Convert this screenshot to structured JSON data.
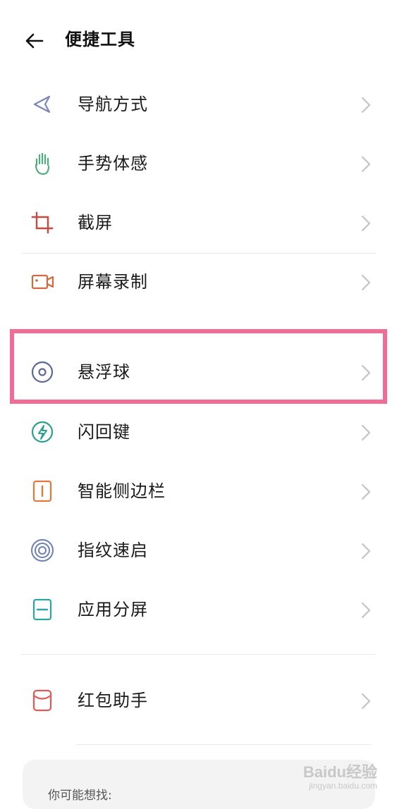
{
  "header": {
    "title": "便捷工具"
  },
  "items": [
    {
      "label": "导航方式",
      "icon": "navigation-arrow-icon"
    },
    {
      "label": "手势体感",
      "icon": "hand-gesture-icon"
    },
    {
      "label": "截屏",
      "icon": "crop-icon"
    },
    {
      "label": "屏幕录制",
      "icon": "video-record-icon"
    },
    {
      "label": "悬浮球",
      "icon": "floating-ball-icon"
    },
    {
      "label": "闪回键",
      "icon": "flash-back-icon"
    },
    {
      "label": "智能侧边栏",
      "icon": "sidebar-icon"
    },
    {
      "label": "指纹速启",
      "icon": "fingerprint-icon"
    },
    {
      "label": "应用分屏",
      "icon": "split-screen-icon"
    },
    {
      "label": "红包助手",
      "icon": "red-envelope-icon"
    }
  ],
  "suggestions": {
    "title": "你可能想找:"
  },
  "watermark": {
    "brand": "Baidu经验",
    "url": "jingyan.baidu.com"
  },
  "colors": {
    "highlight": "#f06b96",
    "chevron": "#c4c4c4"
  }
}
